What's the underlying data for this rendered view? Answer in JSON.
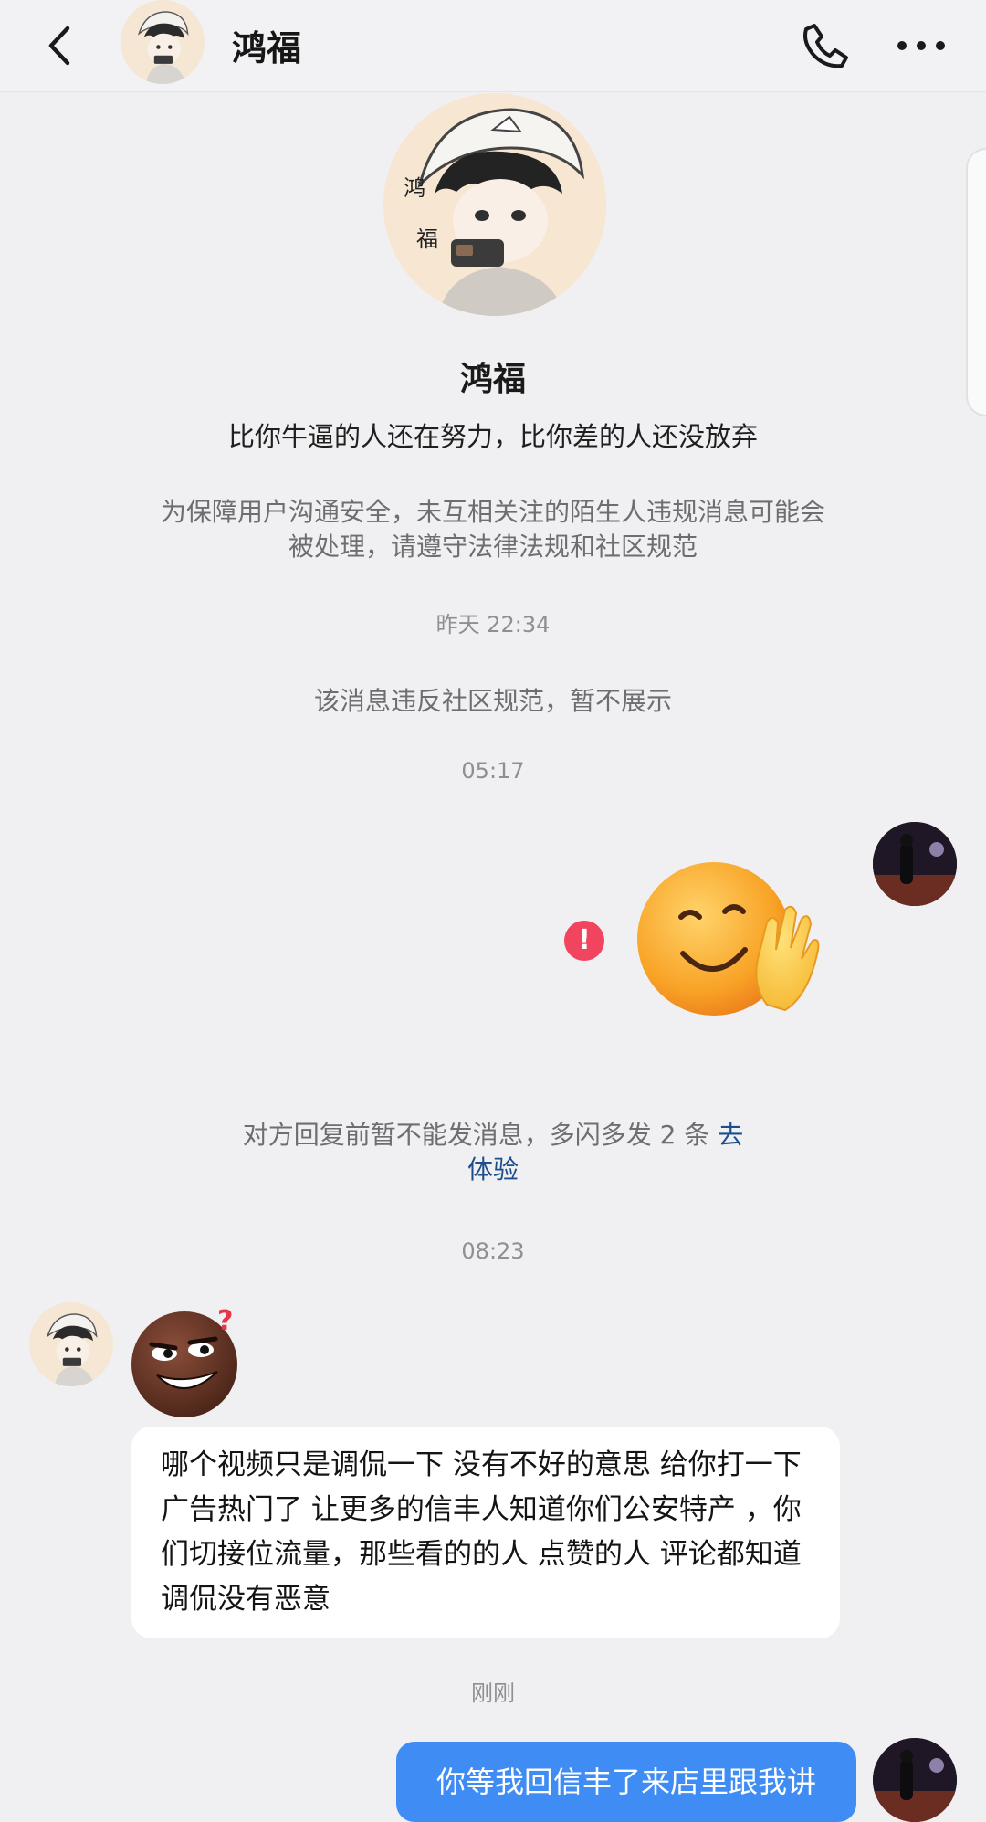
{
  "header": {
    "title": "鸿福",
    "icons": {
      "back": "chevron-left-icon",
      "call": "phone-icon",
      "more": "more-icon"
    }
  },
  "profile": {
    "name": "鸿福",
    "bio": "比你牛逼的人还在努力，比你差的人还没放弃",
    "avatar_glyphs": [
      "鸿",
      "福"
    ]
  },
  "safety_notice": {
    "line1": "为保障用户沟通安全，未互相关注的陌生人违规消息可能会",
    "line2": "被处理，请遵守法律法规和社区规范"
  },
  "messages": {
    "ts1": "昨天 22:34",
    "violation_notice": "该消息违反社区规范，暂不展示",
    "ts2": "05:17",
    "error_mark": "!",
    "reply_hint": "对方回复前暂不能发消息，多闪多发 2 条",
    "reply_hint_link_1": "去",
    "reply_hint_link_2": "体验",
    "ts3": "08:23",
    "incoming_text": "哪个视频只是调侃一下   没有不好的意思   给你打一下广告热门了  让更多的信丰人知道你们公安特产   ，你们切接位流量，那些看的的人 点赞的人  评论都知道调侃没有恶意",
    "ts4": "刚刚",
    "outgoing_text": "你等我回信丰了来店里跟我讲"
  },
  "colors": {
    "background": "#f0f0f2",
    "outgoing_bubble": "#3e8cf4",
    "link": "#1d4e8c",
    "error": "#f0445f"
  }
}
